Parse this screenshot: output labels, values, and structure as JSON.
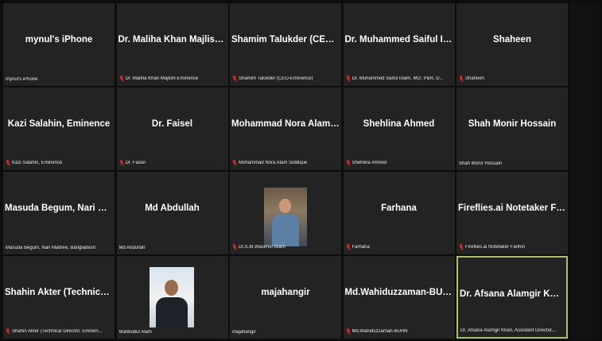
{
  "tiles": [
    {
      "name": "mynul's iPhone",
      "label": "mynul's iPhone",
      "muted": false
    },
    {
      "name": "Dr. Maliha Khan Majlish-E...",
      "label": "Dr. Maliha Khan Majlish-Eminence",
      "muted": true
    },
    {
      "name": "Shamim Talukder (CEO-Em...",
      "label": "Shamim Talukder (CEO-Eminence)",
      "muted": true
    },
    {
      "name": "Dr. Muhammed Saiful Isla...",
      "label": "Dr. Muhammed Saiful Islam, MO, P&R, D...",
      "muted": true
    },
    {
      "name": "Shaheen",
      "label": "Shaheen",
      "muted": true
    },
    {
      "name": "Kazi Salahin, Eminence",
      "label": "Kazi Salahin, Eminence",
      "muted": true
    },
    {
      "name": "Dr. Faisel",
      "label": "Dr. Faisel",
      "muted": true
    },
    {
      "name": "Mohammad Nora Alam Sid...",
      "label": "Mohammad Nora Alam Siddique",
      "muted": true
    },
    {
      "name": "Shehlina Ahmed",
      "label": "Shehlina Ahmed",
      "muted": true
    },
    {
      "name": "Shah Monir Hossain",
      "label": "Shah Monir Hossain",
      "muted": false
    },
    {
      "name": "Masuda Begum, Nari Maitr...",
      "label": "Masuda Begum, Nari Maitree, Bangladesh",
      "muted": false
    },
    {
      "name": "Md Abdullah",
      "label": "Md Abdullah",
      "muted": false
    },
    {
      "name": "",
      "label": "Dr.S.M.Wasimul Islam",
      "muted": true,
      "video": true
    },
    {
      "name": "Farhana",
      "label": "Farhana",
      "muted": true
    },
    {
      "name": "Fireflies.ai Notetaker Farih...",
      "label": "Fireflies.ai Notetaker Farihin",
      "muted": true
    },
    {
      "name": "Shahin Akter (Technical Di...",
      "label": "Shahin Akter (Technical Director, Eminen...",
      "muted": true
    },
    {
      "name": "",
      "label": "Mahbubul Alam",
      "muted": false,
      "video": true
    },
    {
      "name": "majahangir",
      "label": "majahangir",
      "muted": false
    },
    {
      "name": "Md.Wahiduzzaman-BUHN",
      "label": "Md.Wahiduzzaman-BUHN",
      "muted": true
    },
    {
      "name": "Dr. Afsana Alamgir Khan, ...",
      "label": "Dr. Afsana Alamgir Khan, Assistant Director,...",
      "muted": false,
      "active": true
    }
  ],
  "colors": {
    "tile_bg": "#232323",
    "active_border": "#a6c36b",
    "muted_icon": "#e02b2b"
  },
  "icons": {
    "muted": "mic-muted-icon"
  }
}
